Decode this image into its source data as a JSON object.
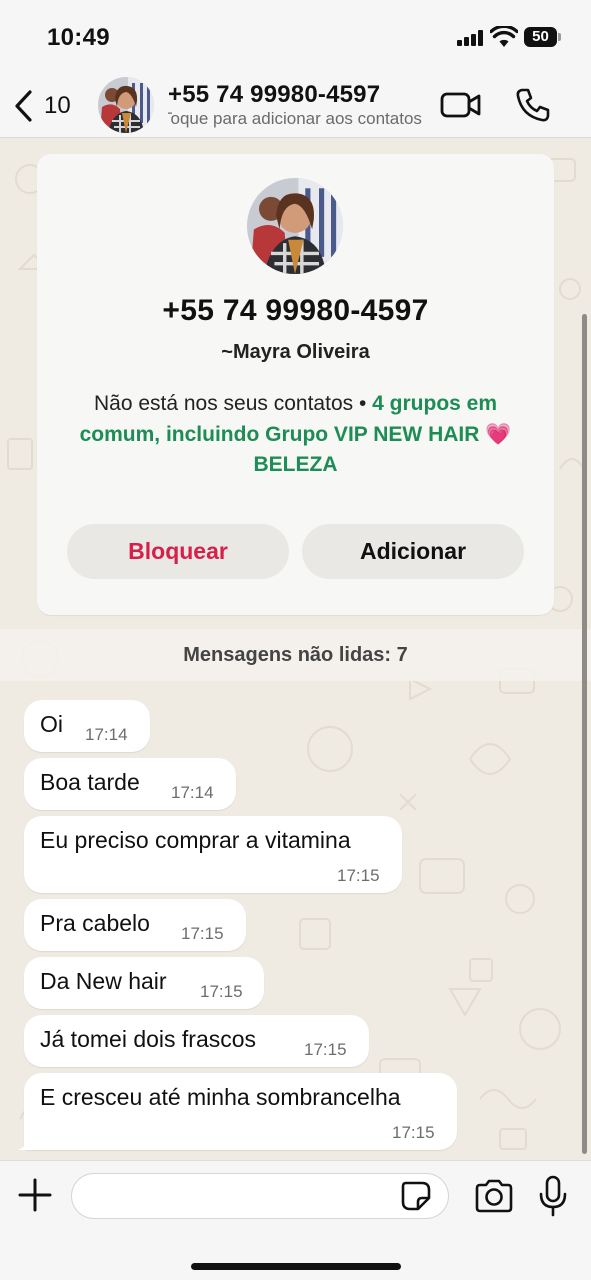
{
  "status_bar": {
    "time": "10:49",
    "battery": "50"
  },
  "header": {
    "back_count": "10",
    "title": "+55 74 99980-4597",
    "subtitle": "Toque para adicionar aos contatos",
    "icons": [
      "chevron-left-icon",
      "video-call-icon",
      "phone-icon"
    ]
  },
  "contact_card": {
    "phone": "+55 74 99980-4597",
    "name": "~Mayra Oliveira",
    "info_prefix": "Não está nos seus contatos • ",
    "info_groups": "4 grupos em comum, incluindo Grupo VIP NEW HAIR 💗 BELEZA",
    "block_label": "Bloquear",
    "add_label": "Adicionar"
  },
  "unread_banner": "Mensagens não lidas: 7",
  "messages": [
    {
      "text": "Oi",
      "time": "17:14"
    },
    {
      "text": "Boa tarde",
      "time": "17:14"
    },
    {
      "text": "Eu preciso comprar a vitamina",
      "time": "17:15"
    },
    {
      "text": "Pra cabelo",
      "time": "17:15"
    },
    {
      "text": "Da New hair",
      "time": "17:15"
    },
    {
      "text": "Já tomei dois frascos",
      "time": "17:15"
    },
    {
      "text": "E cresceu até minha sombrancelha",
      "time": "17:15"
    }
  ],
  "composer": {
    "placeholder": "",
    "icons": [
      "plus-icon",
      "sticker-icon",
      "camera-icon",
      "microphone-icon"
    ]
  },
  "colors": {
    "accent_green": "#1d8c55",
    "block_red": "#d6204a",
    "chat_background": "#efeae2"
  }
}
